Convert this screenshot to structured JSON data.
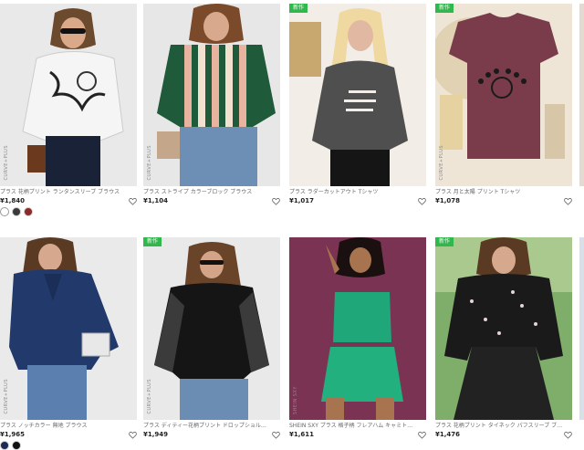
{
  "new_badge_label": "新作",
  "products": [
    {
      "title": "プラス 花柄プリント ランタンスリーブ ブラウス",
      "price": "¥1,840",
      "brand": "CURVE+PLUS",
      "new": false
    },
    {
      "title": "プラス ストライプ カラーブロック ブラウス",
      "price": "¥1,104",
      "brand": "CURVE+PLUS",
      "new": false
    },
    {
      "title": "プラス ラダーカットアウト Tシャツ",
      "price": "¥1,017",
      "brand": "",
      "new": true
    },
    {
      "title": "プラス 月と太陽 プリント Tシャツ",
      "price": "¥1,078",
      "brand": "CURVE+PLUS",
      "new": true
    },
    {
      "title": "プラス ノッチカラー 無地 ブラウス",
      "price": "¥1,965",
      "brand": "CURVE+PLUS",
      "new": false
    },
    {
      "title": "プラス ディティー花柄プリント ドロップショルダー Tシ...",
      "price": "¥1,949",
      "brand": "CURVE+PLUS",
      "new": true
    },
    {
      "title": "SHEIN SXY プラス 格子柄 フレアハム キャミトップ",
      "price": "¥1,611",
      "brand": "SHEIN SXY",
      "new": false
    },
    {
      "title": "プラス 花柄プリント タイネック パフスリーブ ブラウス",
      "price": "¥1,476",
      "brand": "",
      "new": true
    }
  ],
  "swatches_row1": [
    "#ffffff",
    "#3a3a3a",
    "#8b2a2a"
  ],
  "swatches_row2": [
    "#1c2a55",
    "#111111"
  ]
}
